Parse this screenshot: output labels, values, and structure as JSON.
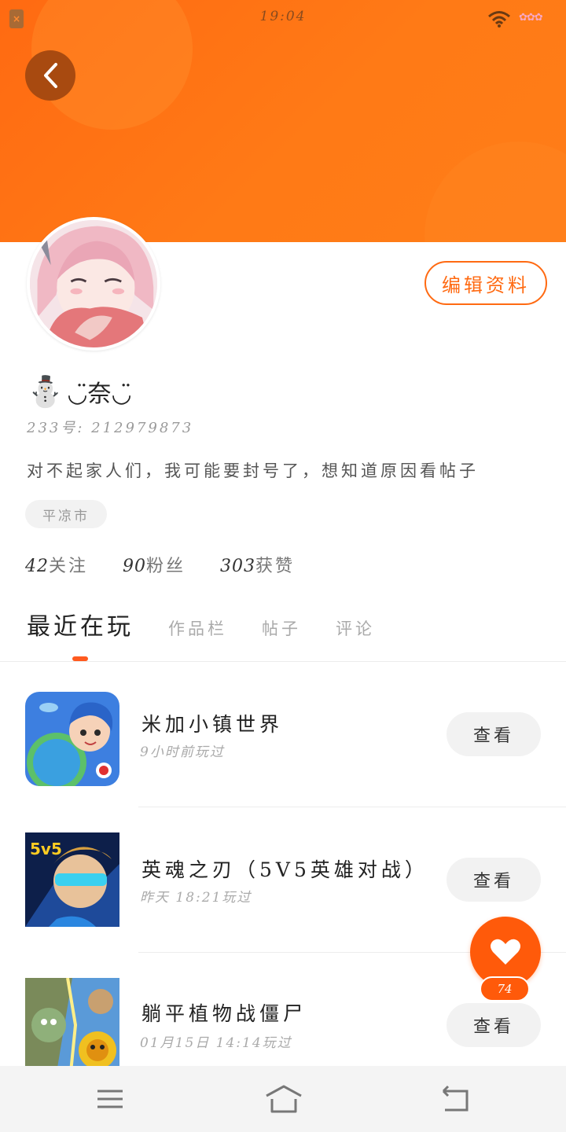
{
  "status_bar": {
    "time": "19:04"
  },
  "profile": {
    "username": "◡̈奈◡̈",
    "avatar_emoji": "⛄",
    "user_id": "233号: 212979873",
    "bio": "对不起家人们，我可能要封号了，想知道原因看帖子",
    "location": "平凉市",
    "edit_label": "编辑资料",
    "stats": [
      {
        "value": "42",
        "label": "关注"
      },
      {
        "value": "90",
        "label": "粉丝"
      },
      {
        "value": "303",
        "label": "获赞"
      }
    ]
  },
  "tabs": [
    {
      "label": "最近在玩"
    },
    {
      "label": "作品栏"
    },
    {
      "label": "帖子"
    },
    {
      "label": "评论"
    }
  ],
  "games": [
    {
      "title": "米加小镇世界",
      "time": "9小时前玩过",
      "button": "查看"
    },
    {
      "title": "英魂之刃（5V5英雄对战）",
      "time": "昨天 18:21玩过",
      "button": "查看"
    },
    {
      "title": "躺平植物战僵尸",
      "time": "01月15日 14:14玩过",
      "button": "查看"
    }
  ],
  "like": {
    "count": "74"
  },
  "colors": {
    "accent": "#ff6a12",
    "header": "#ff7516"
  }
}
